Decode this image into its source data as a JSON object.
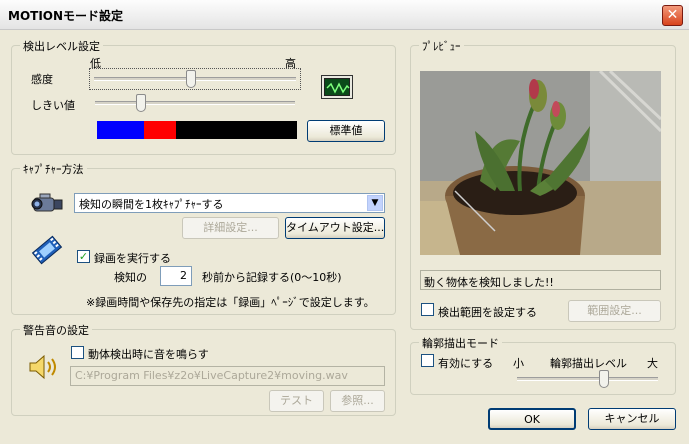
{
  "window": {
    "title": "MOTIONモード設定",
    "close_glyph": "✕"
  },
  "detection": {
    "group_label": "検出レベル設定",
    "low_label": "低",
    "high_label": "高",
    "sensitivity_label": "感度",
    "sensitivity_level": 0.48,
    "threshold_label": "しきい値",
    "threshold_level": 0.22,
    "standard_button": "標準値",
    "level_bar_colors": [
      "#0000ff",
      "#ff0000",
      "#000000"
    ]
  },
  "capture": {
    "group_label": "ｷｬﾌﾟﾁｬｰ方法",
    "method_value": "検知の瞬間を1枚ｷｬﾌﾟﾁｬｰする",
    "detail_button": "詳細設定...",
    "timeout_button": "タイムアウト設定...",
    "record_checkbox_label": "録画を実行する",
    "record_checked": true,
    "before_prefix": "検知の",
    "before_seconds": "2",
    "before_suffix": "秒前から記録する(0～10秒)",
    "note": "※録画時間や保存先の指定は「録画」ﾍﾟｰｼﾞで設定します。"
  },
  "alarm": {
    "group_label": "警告音の設定",
    "sound_checkbox_label": "動体検出時に音を鳴らす",
    "sound_checked": false,
    "file_path": "C:¥Program Files¥z2o¥LiveCapture2¥moving.wav",
    "test_button": "テスト",
    "browse_button": "参照..."
  },
  "preview": {
    "group_label": "ﾌﾟﾚﾋﾞｭｰ",
    "status_text": "動く物体を検知しました!!",
    "range_checkbox_label": "検出範囲を設定する",
    "range_checked": false,
    "range_button": "範囲設定..."
  },
  "outline": {
    "group_label": "輪郭描出モード",
    "enable_label": "有効にする",
    "enable_checked": false,
    "small_label": "小",
    "level_label": "輪郭描出レベル",
    "large_label": "大",
    "level": 0.62
  },
  "footer": {
    "ok_button": "OK",
    "cancel_button": "キャンセル"
  }
}
